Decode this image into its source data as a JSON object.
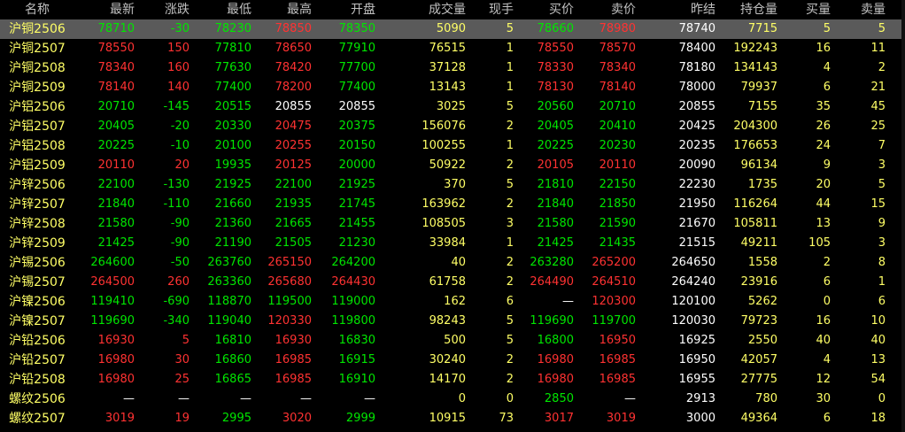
{
  "colors": {
    "up": "#ff3232",
    "down": "#00e600",
    "flat": "#ffffff",
    "name": "#ffff66",
    "header": "#c0c0c0",
    "selected": "#5a5a5a"
  },
  "headers": [
    "名称",
    "最新",
    "涨跌",
    "最低",
    "最高",
    "开盘",
    "成交量",
    "现手",
    "买价",
    "卖价",
    "昨结",
    "持仓量",
    "买量",
    "卖量"
  ],
  "rows": [
    {
      "name": "沪铜2506",
      "last": "78710",
      "change": "-30",
      "low": "78230",
      "high": "78850",
      "open": "78350",
      "volume": "5090",
      "hand": "5",
      "bid": "78660",
      "ask": "78980",
      "prev": "78740",
      "oi": "7715",
      "bid_vol": "5",
      "ask_vol": "5"
    },
    {
      "name": "沪铜2507",
      "last": "78550",
      "change": "150",
      "low": "77810",
      "high": "78650",
      "open": "77910",
      "volume": "76515",
      "hand": "1",
      "bid": "78550",
      "ask": "78570",
      "prev": "78400",
      "oi": "192243",
      "bid_vol": "16",
      "ask_vol": "11"
    },
    {
      "name": "沪铜2508",
      "last": "78340",
      "change": "160",
      "low": "77630",
      "high": "78420",
      "open": "77700",
      "volume": "37128",
      "hand": "1",
      "bid": "78330",
      "ask": "78340",
      "prev": "78180",
      "oi": "134143",
      "bid_vol": "4",
      "ask_vol": "2"
    },
    {
      "name": "沪铜2509",
      "last": "78140",
      "change": "140",
      "low": "77400",
      "high": "78200",
      "open": "77400",
      "volume": "13143",
      "hand": "1",
      "bid": "78130",
      "ask": "78140",
      "prev": "78000",
      "oi": "79937",
      "bid_vol": "6",
      "ask_vol": "21"
    },
    {
      "name": "沪铝2506",
      "last": "20710",
      "change": "-145",
      "low": "20515",
      "high": "20855",
      "open": "20855",
      "volume": "3025",
      "hand": "5",
      "bid": "20560",
      "ask": "20710",
      "prev": "20855",
      "oi": "7155",
      "bid_vol": "35",
      "ask_vol": "45"
    },
    {
      "name": "沪铝2507",
      "last": "20405",
      "change": "-20",
      "low": "20330",
      "high": "20475",
      "open": "20375",
      "volume": "156076",
      "hand": "2",
      "bid": "20405",
      "ask": "20410",
      "prev": "20425",
      "oi": "204300",
      "bid_vol": "26",
      "ask_vol": "25"
    },
    {
      "name": "沪铝2508",
      "last": "20225",
      "change": "-10",
      "low": "20100",
      "high": "20255",
      "open": "20150",
      "volume": "100255",
      "hand": "1",
      "bid": "20225",
      "ask": "20230",
      "prev": "20235",
      "oi": "176653",
      "bid_vol": "24",
      "ask_vol": "7"
    },
    {
      "name": "沪铝2509",
      "last": "20110",
      "change": "20",
      "low": "19935",
      "high": "20125",
      "open": "20000",
      "volume": "50922",
      "hand": "2",
      "bid": "20105",
      "ask": "20110",
      "prev": "20090",
      "oi": "96134",
      "bid_vol": "9",
      "ask_vol": "3"
    },
    {
      "name": "沪锌2506",
      "last": "22100",
      "change": "-130",
      "low": "21925",
      "high": "22100",
      "open": "21925",
      "volume": "370",
      "hand": "5",
      "bid": "21810",
      "ask": "22150",
      "prev": "22230",
      "oi": "1735",
      "bid_vol": "20",
      "ask_vol": "5"
    },
    {
      "name": "沪锌2507",
      "last": "21840",
      "change": "-110",
      "low": "21660",
      "high": "21935",
      "open": "21745",
      "volume": "163962",
      "hand": "2",
      "bid": "21840",
      "ask": "21850",
      "prev": "21950",
      "oi": "116264",
      "bid_vol": "44",
      "ask_vol": "15"
    },
    {
      "name": "沪锌2508",
      "last": "21580",
      "change": "-90",
      "low": "21360",
      "high": "21665",
      "open": "21455",
      "volume": "108505",
      "hand": "3",
      "bid": "21580",
      "ask": "21590",
      "prev": "21670",
      "oi": "105811",
      "bid_vol": "13",
      "ask_vol": "9"
    },
    {
      "name": "沪锌2509",
      "last": "21425",
      "change": "-90",
      "low": "21190",
      "high": "21505",
      "open": "21230",
      "volume": "33984",
      "hand": "1",
      "bid": "21425",
      "ask": "21435",
      "prev": "21515",
      "oi": "49211",
      "bid_vol": "105",
      "ask_vol": "3"
    },
    {
      "name": "沪锡2506",
      "last": "264600",
      "change": "-50",
      "low": "263760",
      "high": "265150",
      "open": "264200",
      "volume": "40",
      "hand": "2",
      "bid": "263280",
      "ask": "265200",
      "prev": "264650",
      "oi": "1558",
      "bid_vol": "2",
      "ask_vol": "8"
    },
    {
      "name": "沪锡2507",
      "last": "264500",
      "change": "260",
      "low": "263360",
      "high": "265680",
      "open": "264430",
      "volume": "61758",
      "hand": "2",
      "bid": "264490",
      "ask": "264510",
      "prev": "264240",
      "oi": "23916",
      "bid_vol": "6",
      "ask_vol": "1"
    },
    {
      "name": "沪镍2506",
      "last": "119410",
      "change": "-690",
      "low": "118870",
      "high": "119500",
      "open": "119000",
      "volume": "162",
      "hand": "6",
      "bid": "—",
      "ask": "120300",
      "prev": "120100",
      "oi": "5262",
      "bid_vol": "0",
      "ask_vol": "6"
    },
    {
      "name": "沪镍2507",
      "last": "119690",
      "change": "-340",
      "low": "119040",
      "high": "120330",
      "open": "119800",
      "volume": "98243",
      "hand": "5",
      "bid": "119690",
      "ask": "119700",
      "prev": "120030",
      "oi": "79723",
      "bid_vol": "16",
      "ask_vol": "10"
    },
    {
      "name": "沪铅2506",
      "last": "16930",
      "change": "5",
      "low": "16810",
      "high": "16930",
      "open": "16830",
      "volume": "500",
      "hand": "5",
      "bid": "16800",
      "ask": "16950",
      "prev": "16925",
      "oi": "2550",
      "bid_vol": "40",
      "ask_vol": "40"
    },
    {
      "name": "沪铅2507",
      "last": "16980",
      "change": "30",
      "low": "16860",
      "high": "16985",
      "open": "16915",
      "volume": "30240",
      "hand": "2",
      "bid": "16980",
      "ask": "16985",
      "prev": "16950",
      "oi": "42057",
      "bid_vol": "4",
      "ask_vol": "13"
    },
    {
      "name": "沪铅2508",
      "last": "16980",
      "change": "25",
      "low": "16865",
      "high": "16985",
      "open": "16910",
      "volume": "14170",
      "hand": "2",
      "bid": "16980",
      "ask": "16985",
      "prev": "16955",
      "oi": "27775",
      "bid_vol": "12",
      "ask_vol": "54"
    },
    {
      "name": "螺纹2506",
      "last": "—",
      "change": "—",
      "low": "—",
      "high": "—",
      "open": "—",
      "volume": "0",
      "hand": "0",
      "bid": "2850",
      "ask": "—",
      "prev": "2913",
      "oi": "780",
      "bid_vol": "30",
      "ask_vol": "0"
    },
    {
      "name": "螺纹2507",
      "last": "3019",
      "change": "19",
      "low": "2995",
      "high": "3020",
      "open": "2999",
      "volume": "10915",
      "hand": "73",
      "bid": "3017",
      "ask": "3019",
      "prev": "3000",
      "oi": "49364",
      "bid_vol": "6",
      "ask_vol": "18"
    }
  ],
  "selected_row": 0
}
